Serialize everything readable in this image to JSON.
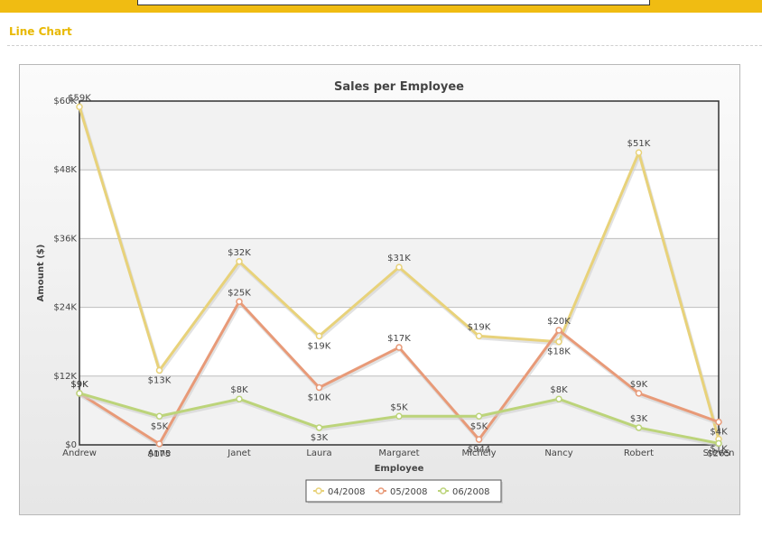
{
  "page": {
    "section_title": "Line Chart"
  },
  "chart_data": {
    "type": "line",
    "title": "Sales per Employee",
    "xlabel": "Employee",
    "ylabel": "Amount ($)",
    "ylim": [
      0,
      60000
    ],
    "yticks": [
      "$0",
      "$12K",
      "$24K",
      "$36K",
      "$48K",
      "$60K"
    ],
    "categories": [
      "Andrew",
      "Anne",
      "Janet",
      "Laura",
      "Margaret",
      "Michely",
      "Nancy",
      "Robert",
      "Steven"
    ],
    "legend_position": "bottom-center",
    "series": [
      {
        "name": "04/2008",
        "color": "#e8d27a",
        "values": [
          59000,
          13000,
          32000,
          19000,
          31000,
          19000,
          18000,
          51000,
          1000
        ],
        "labels": [
          "$59K",
          "$13K",
          "$32K",
          "$19K",
          "$31K",
          "$19K",
          "$18K",
          "$51K",
          "$1K"
        ]
      },
      {
        "name": "05/2008",
        "color": "#e89a78",
        "values": [
          9000,
          175,
          25000,
          10000,
          17000,
          944,
          20000,
          9000,
          4000
        ],
        "labels": [
          "$9K",
          "$175",
          "$25K",
          "$10K",
          "$17K",
          "$944",
          "$20K",
          "$9K",
          "$4K"
        ]
      },
      {
        "name": "06/2008",
        "color": "#bcd47a",
        "values": [
          9000,
          5000,
          8000,
          3000,
          5000,
          5000,
          8000,
          3000,
          265
        ],
        "labels": [
          "$9K",
          "$5K",
          "$8K",
          "$3K",
          "$5K",
          "$5K",
          "$8K",
          "$3K",
          "$265"
        ]
      }
    ]
  }
}
